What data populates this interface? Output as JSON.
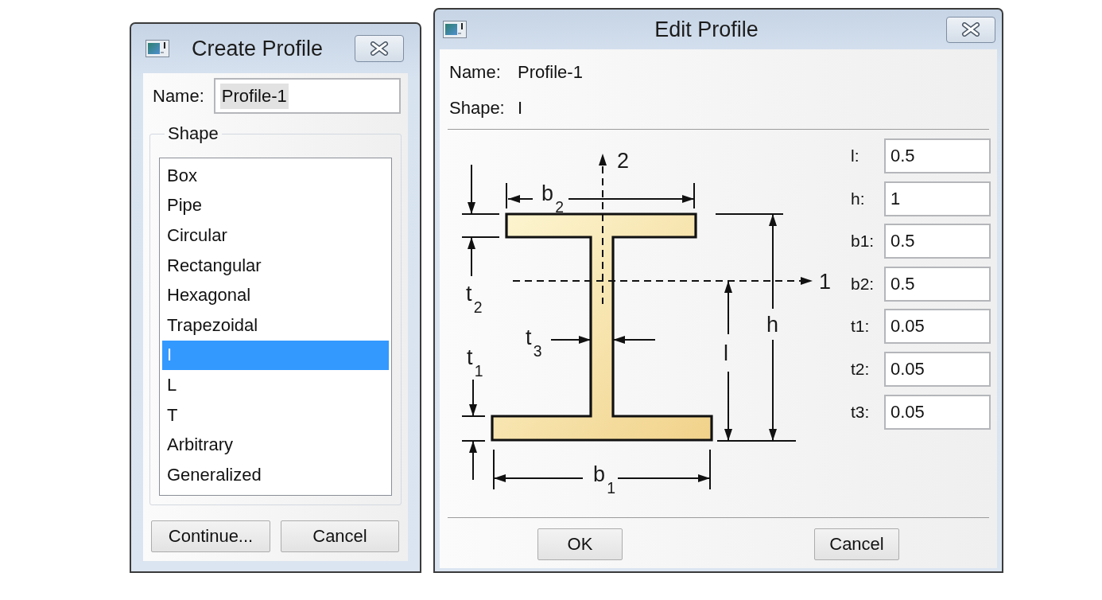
{
  "create_dialog": {
    "title": "Create Profile",
    "name_label": "Name:",
    "name_field": {
      "value": "Profile-1",
      "value_selected": true
    },
    "shape_group": {
      "title": "Shape",
      "items": [
        {
          "label": "Box",
          "selected": false
        },
        {
          "label": "Pipe",
          "selected": false
        },
        {
          "label": "Circular",
          "selected": false
        },
        {
          "label": "Rectangular",
          "selected": false
        },
        {
          "label": "Hexagonal",
          "selected": false
        },
        {
          "label": "Trapezoidal",
          "selected": false
        },
        {
          "label": "I",
          "selected": true
        },
        {
          "label": "L",
          "selected": false
        },
        {
          "label": "T",
          "selected": false
        },
        {
          "label": "Arbitrary",
          "selected": false
        },
        {
          "label": "Generalized",
          "selected": false
        }
      ]
    },
    "buttons": [
      "Continue...",
      "Cancel"
    ]
  },
  "edit_dialog": {
    "title": "Edit Profile",
    "info": [
      {
        "label": "Name:",
        "value": "Profile-1"
      },
      {
        "label": "Shape:",
        "value": "I"
      }
    ],
    "diagram": {
      "vertical_axis": "2",
      "horizontal_axis": "1",
      "top_width": "b$_{2}$",
      "top_thickness": "t$_{2}$",
      "web_thickness": "t$_{3}$",
      "bottom_thickness": "t$_{1}$",
      "bottom_width": "b$_{1}$",
      "height": "h",
      "axis_height": "l"
    },
    "parameters": [
      {
        "label": "l:",
        "value": "0.5"
      },
      {
        "label": "h:",
        "value": "1"
      },
      {
        "label": "b1:",
        "value": "0.5"
      },
      {
        "label": "b2:",
        "value": "0.5"
      },
      {
        "label": "t1:",
        "value": "0.05"
      },
      {
        "label": "t2:",
        "value": "0.05"
      },
      {
        "label": "t3:",
        "value": "0.05"
      }
    ],
    "buttons": [
      "OK",
      "Cancel"
    ]
  }
}
